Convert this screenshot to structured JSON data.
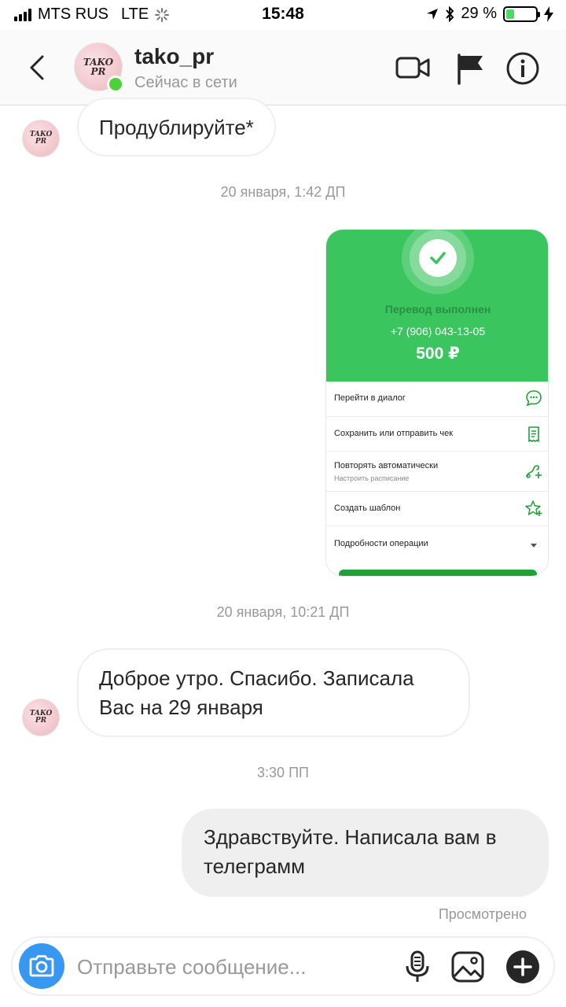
{
  "status_bar": {
    "carrier": "MTS RUS",
    "network": "LTE",
    "time": "15:48",
    "battery": "29 %",
    "battery_level": 0.29
  },
  "header": {
    "username": "tako_pr",
    "status": "Сейчас в сети",
    "avatar_text_line1": "TAKO",
    "avatar_text_line2": "PR"
  },
  "messages": {
    "msg1": "Продублируйте*",
    "ts1": "20 января, 1:42 ДП",
    "ts2": "20 января, 10:21 ДП",
    "msg2_line1": "Доброе утро. Спасибо. Записала",
    "msg2_line2": "Вас на 29 января",
    "ts3": "3:30 ПП",
    "msg3_line1": "Здравствуйте. Написала вам в",
    "msg3_line2": "телеграмм",
    "seen": "Просмотрено"
  },
  "receipt": {
    "title": "Перевод выполнен",
    "phone": "+7 (906) 043-13-05",
    "amount": "500 ₽",
    "rows": [
      {
        "label": "Перейти в диалог",
        "icon": "chat-icon"
      },
      {
        "label": "Сохранить или отправить чек",
        "icon": "receipt-icon"
      },
      {
        "label": "Повторять автоматически",
        "sub": "Настроить расписание",
        "icon": "repeat-plus-icon"
      },
      {
        "label": "Создать шаблон",
        "icon": "star-plus-icon"
      },
      {
        "label": "Подробности операции",
        "icon": "triangle-down-icon"
      }
    ]
  },
  "composer": {
    "placeholder": "Отправьте сообщение..."
  },
  "colors": {
    "accent_blue": "#3897f0",
    "online_green": "#4cd137",
    "receipt_green": "#3bc55e"
  }
}
